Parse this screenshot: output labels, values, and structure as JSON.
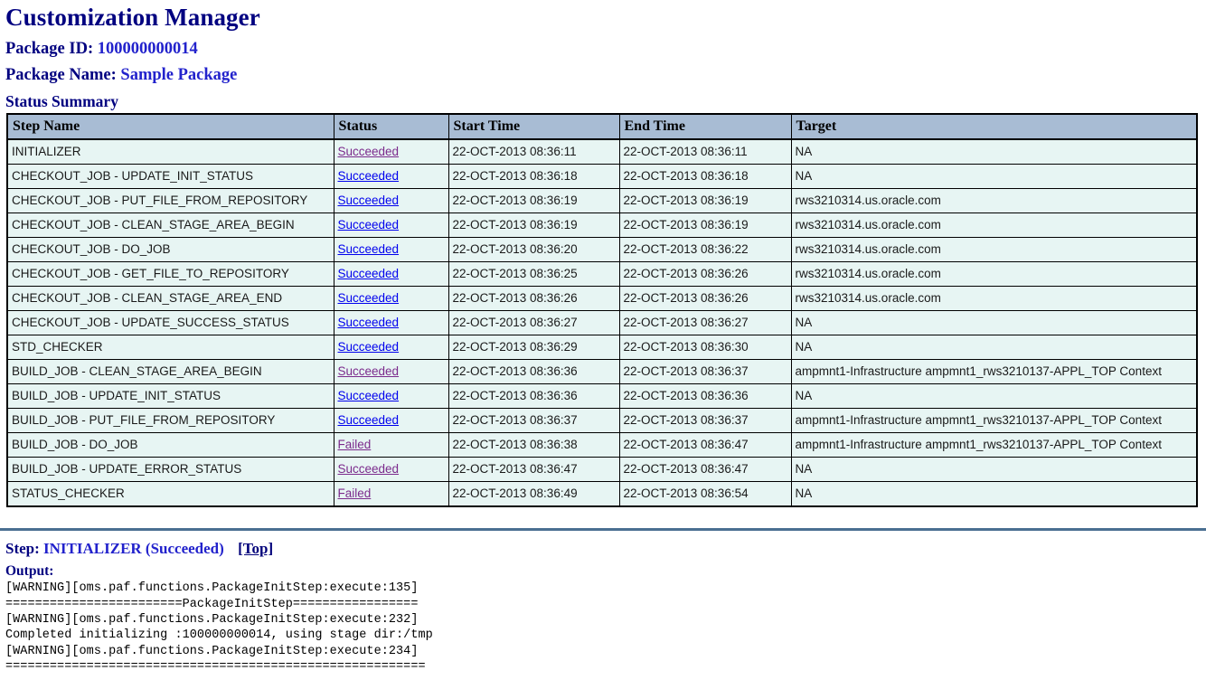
{
  "page": {
    "title": "Customization Manager",
    "package_id_label": "Package ID:",
    "package_id_value": "100000000014",
    "package_name_label": "Package Name:",
    "package_name_value": "Sample Package",
    "status_summary_heading": "Status Summary"
  },
  "table": {
    "columns": [
      "Step Name",
      "Status",
      "Start Time",
      "End Time",
      "Target"
    ],
    "rows": [
      {
        "step": "INITIALIZER",
        "status": "Succeeded",
        "status_state": "visited",
        "start": "22-OCT-2013 08:36:11",
        "end": "22-OCT-2013 08:36:11",
        "target": "NA"
      },
      {
        "step": "CHECKOUT_JOB - UPDATE_INIT_STATUS",
        "status": "Succeeded",
        "status_state": "link",
        "start": "22-OCT-2013 08:36:18",
        "end": "22-OCT-2013 08:36:18",
        "target": "NA"
      },
      {
        "step": "CHECKOUT_JOB - PUT_FILE_FROM_REPOSITORY",
        "status": "Succeeded",
        "status_state": "link",
        "start": "22-OCT-2013 08:36:19",
        "end": "22-OCT-2013 08:36:19",
        "target": "rws3210314.us.oracle.com"
      },
      {
        "step": "CHECKOUT_JOB - CLEAN_STAGE_AREA_BEGIN",
        "status": "Succeeded",
        "status_state": "link",
        "start": "22-OCT-2013 08:36:19",
        "end": "22-OCT-2013 08:36:19",
        "target": "rws3210314.us.oracle.com"
      },
      {
        "step": "CHECKOUT_JOB - DO_JOB",
        "status": "Succeeded",
        "status_state": "link",
        "start": "22-OCT-2013 08:36:20",
        "end": "22-OCT-2013 08:36:22",
        "target": "rws3210314.us.oracle.com"
      },
      {
        "step": "CHECKOUT_JOB - GET_FILE_TO_REPOSITORY",
        "status": "Succeeded",
        "status_state": "link",
        "start": "22-OCT-2013 08:36:25",
        "end": "22-OCT-2013 08:36:26",
        "target": "rws3210314.us.oracle.com"
      },
      {
        "step": "CHECKOUT_JOB - CLEAN_STAGE_AREA_END",
        "status": "Succeeded",
        "status_state": "link",
        "start": "22-OCT-2013 08:36:26",
        "end": "22-OCT-2013 08:36:26",
        "target": "rws3210314.us.oracle.com"
      },
      {
        "step": "CHECKOUT_JOB - UPDATE_SUCCESS_STATUS",
        "status": "Succeeded",
        "status_state": "link",
        "start": "22-OCT-2013 08:36:27",
        "end": "22-OCT-2013 08:36:27",
        "target": "NA"
      },
      {
        "step": "STD_CHECKER",
        "status": "Succeeded",
        "status_state": "link",
        "start": "22-OCT-2013 08:36:29",
        "end": "22-OCT-2013 08:36:30",
        "target": "NA"
      },
      {
        "step": "BUILD_JOB - CLEAN_STAGE_AREA_BEGIN",
        "status": "Succeeded",
        "status_state": "visited",
        "start": "22-OCT-2013 08:36:36",
        "end": "22-OCT-2013 08:36:37",
        "target": "ampmnt1-Infrastructure ampmnt1_rws3210137-APPL_TOP Context"
      },
      {
        "step": "BUILD_JOB - UPDATE_INIT_STATUS",
        "status": "Succeeded",
        "status_state": "link",
        "start": "22-OCT-2013 08:36:36",
        "end": "22-OCT-2013 08:36:36",
        "target": "NA"
      },
      {
        "step": "BUILD_JOB - PUT_FILE_FROM_REPOSITORY",
        "status": "Succeeded",
        "status_state": "link",
        "start": "22-OCT-2013 08:36:37",
        "end": "22-OCT-2013 08:36:37",
        "target": "ampmnt1-Infrastructure ampmnt1_rws3210137-APPL_TOP Context"
      },
      {
        "step": "BUILD_JOB - DO_JOB",
        "status": "Failed",
        "status_state": "visited",
        "start": "22-OCT-2013 08:36:38",
        "end": "22-OCT-2013 08:36:47",
        "target": "ampmnt1-Infrastructure ampmnt1_rws3210137-APPL_TOP Context"
      },
      {
        "step": "BUILD_JOB - UPDATE_ERROR_STATUS",
        "status": "Succeeded",
        "status_state": "visited",
        "start": "22-OCT-2013 08:36:47",
        "end": "22-OCT-2013 08:36:47",
        "target": "NA"
      },
      {
        "step": "STATUS_CHECKER",
        "status": "Failed",
        "status_state": "visited",
        "start": "22-OCT-2013 08:36:49",
        "end": "22-OCT-2013 08:36:54",
        "target": "NA"
      }
    ]
  },
  "detail": {
    "step_label": "Step:",
    "step_name": "INITIALIZER (Succeeded)",
    "top_link": "[Top]",
    "output_label": "Output:",
    "output_text": "[WARNING][oms.paf.functions.PackageInitStep:execute:135]\n========================PackageInitStep=================\n[WARNING][oms.paf.functions.PackageInitStep:execute:232]\nCompleted initializing :100000000014, using stage dir:/tmp\n[WARNING][oms.paf.functions.PackageInitStep:execute:234]\n========================================================="
  },
  "colors": {
    "heading": "#000080",
    "accent_value": "#2222cc",
    "table_header_bg": "#a8bcd4",
    "table_row_bg": "#e7f5f3",
    "link": "#0000ee",
    "visited_link": "#7b2a8c",
    "divider": "#4a6f91"
  }
}
